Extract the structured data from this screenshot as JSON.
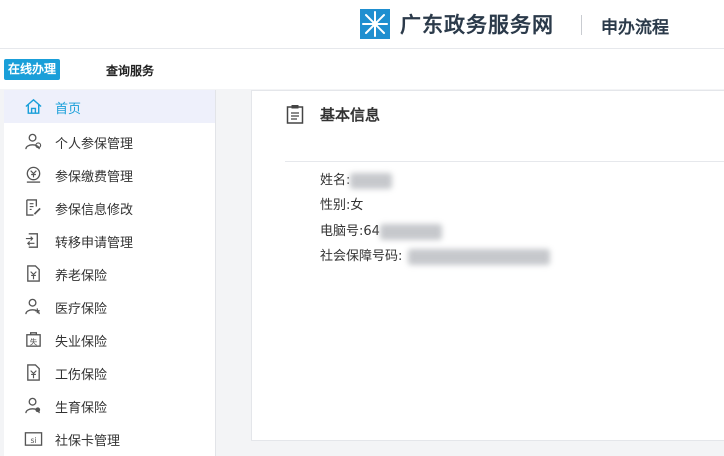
{
  "header": {
    "site_title": "广东政务服务网",
    "section_title": "申办流程"
  },
  "tabs": {
    "online": "在线办理",
    "query": "查询服务"
  },
  "sidebar": {
    "items": [
      {
        "label": "首页",
        "icon": "home-icon",
        "active": true
      },
      {
        "label": "个人参保管理",
        "icon": "person-icon"
      },
      {
        "label": "参保缴费管理",
        "icon": "payment-icon"
      },
      {
        "label": "参保信息修改",
        "icon": "edit-document-icon"
      },
      {
        "label": "转移申请管理",
        "icon": "transfer-icon"
      },
      {
        "label": "养老保险",
        "icon": "pension-icon"
      },
      {
        "label": "医疗保险",
        "icon": "medical-icon"
      },
      {
        "label": "失业保险",
        "icon": "unemployment-icon"
      },
      {
        "label": "工伤保险",
        "icon": "injury-icon"
      },
      {
        "label": "生育保险",
        "icon": "maternity-icon"
      },
      {
        "label": "社保卡管理",
        "icon": "si-card-icon"
      }
    ]
  },
  "basic_info": {
    "title": "基本信息",
    "name_label": "姓名:",
    "gender_label": "性别:",
    "gender_value": "女",
    "computer_no_label": "电脑号:",
    "computer_no_prefix": "64",
    "ssn_label": "社会保障号码:"
  },
  "colors": {
    "accent": "#1a9fd9",
    "active_bg": "#eef0fb"
  }
}
